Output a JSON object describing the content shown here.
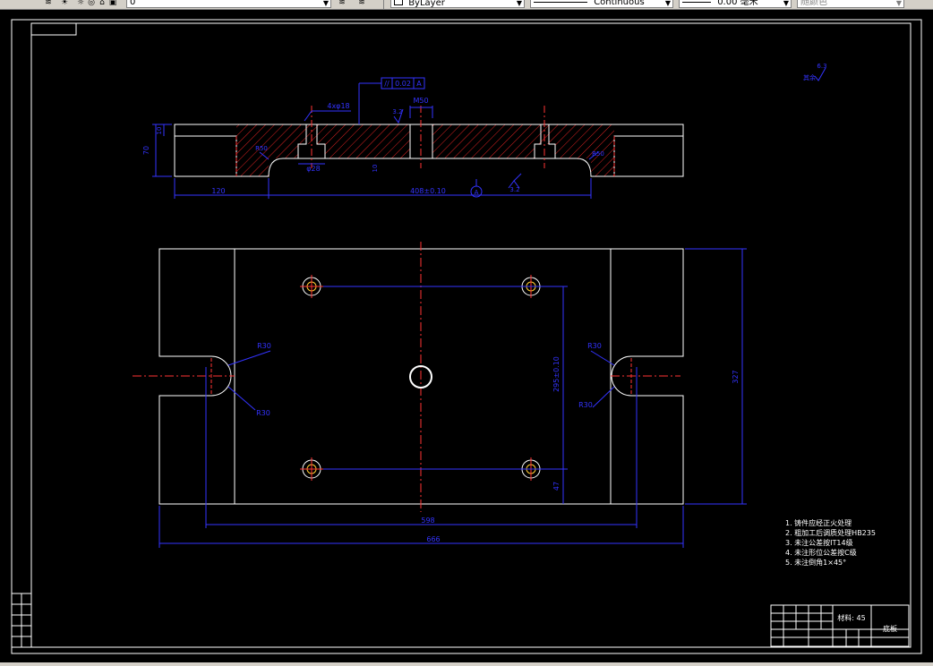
{
  "toolbar": {
    "layer_value": "0",
    "color_value": "ByLayer",
    "linetype_value": "Continuous",
    "lineweight_value": "0.00 毫米",
    "plotstyle_value": "随颜色"
  },
  "drawing": {
    "dims": {
      "d_70": "70",
      "d_10": "10",
      "d_4xphi18": "4xφ18",
      "d_phi28": "φ28",
      "d_m50": "M50",
      "d_r50_left": "R50",
      "d_r50_right": "R50",
      "d_10_low": "10",
      "d_120": "120",
      "d_408": "408±0.10",
      "d_a_symbol": "A",
      "d_32_bottom": "3.2",
      "d_tol_symbol": "//",
      "d_tol_value": "0.02",
      "d_tol_datum": "A",
      "d_roughness": "3.2",
      "d_roughness_top": "6.3",
      "d_roughness_label": "其余",
      "d_r30_a": "R30",
      "d_r30_b": "R30",
      "d_r30_c": "R30",
      "d_r30_d": "R30",
      "d_295": "295±0.10",
      "d_47": "47",
      "d_327": "327",
      "d_598": "598",
      "d_666": "666"
    },
    "notes": [
      "1. 铸件应经正火处理",
      "2. 粗加工后调质处理HB235",
      "3. 未注公差按IT14级",
      "4. 未注形位公差按C级",
      "5. 未注倒角1×45°"
    ],
    "title_block": {
      "material": "材料: 45",
      "part_name": "底板"
    }
  }
}
